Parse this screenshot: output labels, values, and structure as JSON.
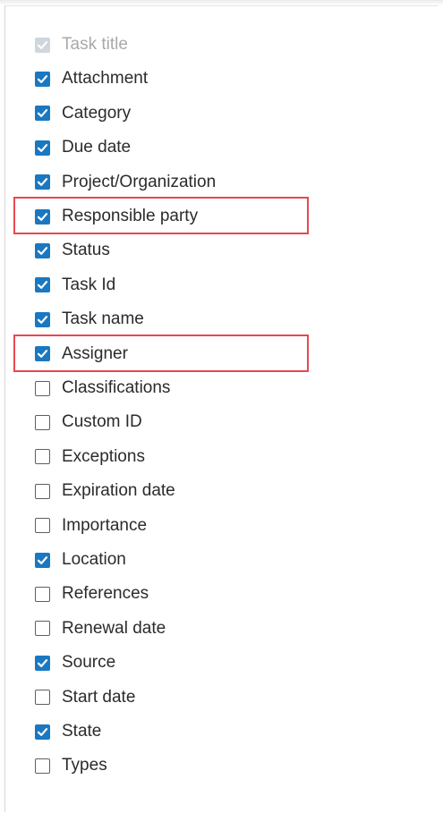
{
  "column_options": [
    {
      "label": "Task title",
      "checked": true,
      "disabled": true
    },
    {
      "label": "Attachment",
      "checked": true,
      "disabled": false
    },
    {
      "label": "Category",
      "checked": true,
      "disabled": false
    },
    {
      "label": "Due date",
      "checked": true,
      "disabled": false
    },
    {
      "label": "Project/Organization",
      "checked": true,
      "disabled": false
    },
    {
      "label": "Responsible party",
      "checked": true,
      "disabled": false,
      "highlighted": true
    },
    {
      "label": "Status",
      "checked": true,
      "disabled": false
    },
    {
      "label": "Task Id",
      "checked": true,
      "disabled": false
    },
    {
      "label": "Task name",
      "checked": true,
      "disabled": false
    },
    {
      "label": "Assigner",
      "checked": true,
      "disabled": false,
      "highlighted": true
    },
    {
      "label": "Classifications",
      "checked": false,
      "disabled": false
    },
    {
      "label": "Custom ID",
      "checked": false,
      "disabled": false
    },
    {
      "label": "Exceptions",
      "checked": false,
      "disabled": false
    },
    {
      "label": "Expiration date",
      "checked": false,
      "disabled": false
    },
    {
      "label": "Importance",
      "checked": false,
      "disabled": false
    },
    {
      "label": "Location",
      "checked": true,
      "disabled": false
    },
    {
      "label": "References",
      "checked": false,
      "disabled": false
    },
    {
      "label": "Renewal date",
      "checked": false,
      "disabled": false
    },
    {
      "label": "Source",
      "checked": true,
      "disabled": false
    },
    {
      "label": "Start date",
      "checked": false,
      "disabled": false
    },
    {
      "label": "State",
      "checked": true,
      "disabled": false
    },
    {
      "label": "Types",
      "checked": false,
      "disabled": false
    }
  ],
  "colors": {
    "checkbox_checked": "#1a78c2",
    "highlight_border": "#e8474f",
    "label_text": "#2b2b2b",
    "disabled_text": "#a9a9a9"
  },
  "icons": {
    "checked": "checkmark-icon",
    "unchecked": "empty-checkbox-icon"
  }
}
